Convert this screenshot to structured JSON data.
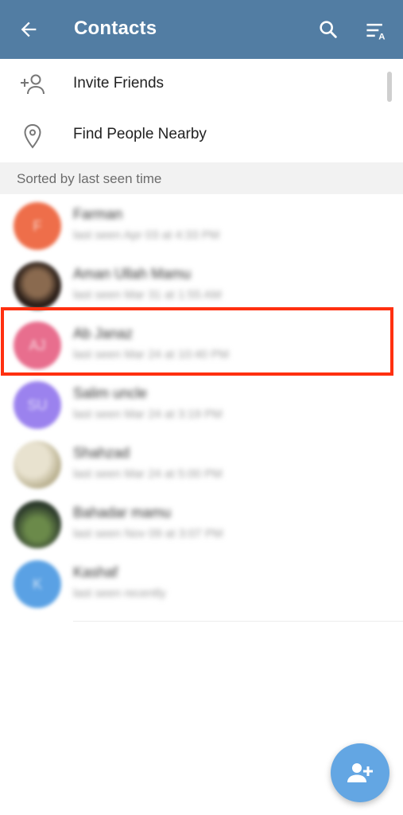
{
  "header": {
    "title": "Contacts",
    "icons": [
      "back-arrow-icon",
      "search-icon",
      "sort-icon"
    ],
    "background": "#527da3"
  },
  "actions": [
    {
      "label": "Invite Friends",
      "icon": "add-person-icon"
    },
    {
      "label": "Find People Nearby",
      "icon": "location-pin-icon"
    }
  ],
  "section_header": "Sorted by last seen time",
  "contacts": [
    {
      "name": "Farman",
      "status": "last seen Apr 03 at 4:33 PM",
      "initials": "F",
      "avatar_color": "#ee6e4a"
    },
    {
      "name": "Aman Ullah Mamu",
      "status": "last seen Mar 31 at 1:55 AM",
      "initials": "",
      "avatar_color": "#3b2a20"
    },
    {
      "name": "Ab Janaz",
      "status": "last seen Mar 24 at 10:40 PM",
      "initials": "AJ",
      "avatar_color": "#e86e8e"
    },
    {
      "name": "Salim uncle",
      "status": "last seen Mar 24 at 3:19 PM",
      "initials": "SU",
      "avatar_color": "#9b82ee"
    },
    {
      "name": "Shahzad",
      "status": "last seen Mar 24 at 5:00 PM",
      "initials": "",
      "avatar_color": "#d9d4c4"
    },
    {
      "name": "Bahadar mamu",
      "status": "last seen Nov 09 at 3:07 PM",
      "initials": "",
      "avatar_color": "#4a5a48"
    },
    {
      "name": "Kashaf",
      "status": "last seen recently",
      "initials": "K",
      "avatar_color": "#5aa1e4"
    }
  ],
  "fab": {
    "icon": "add-contact-icon",
    "color": "#63a6e3"
  }
}
